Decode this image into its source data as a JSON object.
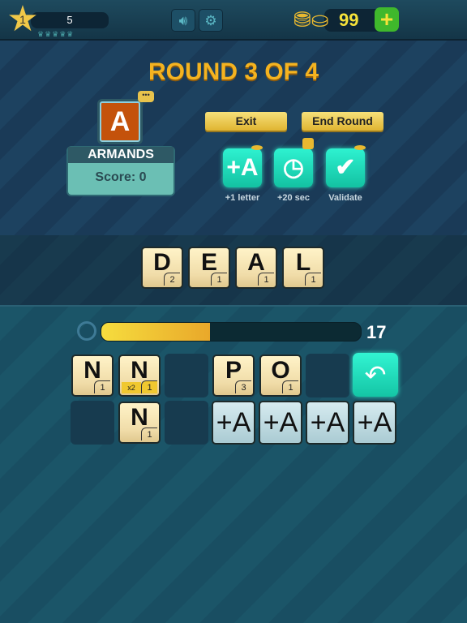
{
  "header": {
    "level": "1",
    "xp": "5",
    "coins": "99"
  },
  "round_title": "ROUND 3 OF 4",
  "player": {
    "avatar_letter": "A",
    "name": "ARMANDS",
    "score": "Score: 0"
  },
  "buttons": {
    "exit": "Exit",
    "end_round": "End Round"
  },
  "powerups": [
    {
      "label": "+1 letter",
      "icon": "+A"
    },
    {
      "label": "+20 sec",
      "icon": "clock-icon"
    },
    {
      "label": "Validate",
      "icon": "check-icon"
    }
  ],
  "word": [
    {
      "letter": "D",
      "value": "2"
    },
    {
      "letter": "E",
      "value": "1"
    },
    {
      "letter": "A",
      "value": "1"
    },
    {
      "letter": "L",
      "value": "1"
    }
  ],
  "timer": {
    "seconds": "17",
    "fill_fraction": 0.42
  },
  "rack": {
    "row1": [
      {
        "letter": "N",
        "value": "1"
      },
      {
        "letter": "N",
        "value": "1",
        "multiplier": "x2"
      },
      null,
      {
        "letter": "P",
        "value": "3"
      },
      {
        "letter": "O",
        "value": "1"
      },
      null,
      "undo"
    ],
    "row2": [
      null,
      {
        "letter": "N",
        "value": "1"
      },
      null,
      "+A",
      "+A",
      "+A",
      "+A"
    ]
  },
  "colors": {
    "accent_teal": "#1fd9b8",
    "gold": "#f4b320",
    "tile": "#f6e6b8"
  }
}
